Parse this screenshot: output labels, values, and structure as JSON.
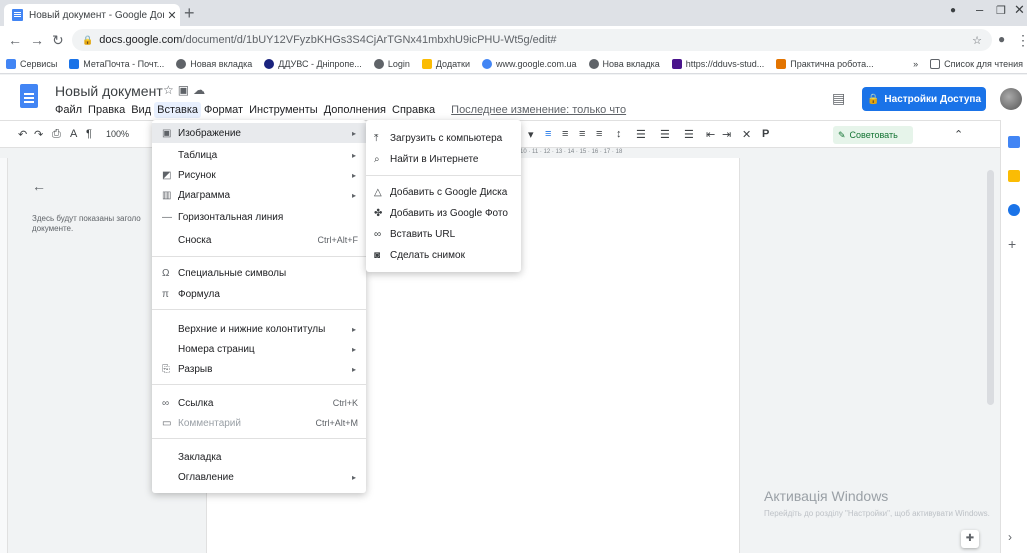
{
  "browser": {
    "tab_title": "Новый документ - Google Доку",
    "url_domain": "docs.google.com",
    "url_path": "/document/d/1bUY12VFyzbKHGs3S4CjArTGNx41mbxhU9icPHU-Wt5g/edit#",
    "bookmarks": [
      "Сервисы",
      "МетаПочта - Почт...",
      "Новая вкладка",
      "ДДУВС - Дніпропе...",
      "Login",
      "Додатки",
      "www.google.com.ua",
      "Нова вкладка",
      "https://dduvs-stud...",
      "Практична робота..."
    ],
    "bookmarks_more": "»",
    "reading_list": "Список для чтения"
  },
  "doc": {
    "title": "Новый документ",
    "menus": [
      "Файл",
      "Правка",
      "Вид",
      "Вставка",
      "Формат",
      "Инструменты",
      "Дополнения",
      "Справка"
    ],
    "last_edit": "Последнее изменение: только что",
    "share": "Настройки Доступа",
    "zoom": "100%",
    "suggest": "Советовать",
    "outline_hint": "Здесь будут показаны заголо документе.",
    "ruler": "10 · 11 · 12 · 13 · 14 · 15 · 16 · 17 · 18"
  },
  "insert_menu": {
    "image": "Изображение",
    "table": "Таблица",
    "drawing": "Рисунок",
    "chart": "Диаграмма",
    "hline": "Горизонтальная линия",
    "footnote": "Сноска",
    "footnote_sc": "Ctrl+Alt+F",
    "special": "Специальные символы",
    "equation": "Формула",
    "headers": "Верхние и нижние колонтитулы",
    "pagenums": "Номера страниц",
    "break": "Разрыв",
    "link": "Ссылка",
    "link_sc": "Ctrl+K",
    "comment": "Комментарий",
    "comment_sc": "Ctrl+Alt+M",
    "bookmark": "Закладка",
    "toc": "Оглавление"
  },
  "image_menu": {
    "upload": "Загрузить с компьютера",
    "search": "Найти в Интернете",
    "drive": "Добавить с Google Диска",
    "photos": "Добавить из Google Фото",
    "url": "Вставить URL",
    "camera": "Сделать снимок"
  },
  "watermark": {
    "title": "Активація Windows",
    "text": "Перейдіть до розділу \"Настройки\", щоб активувати Windows."
  }
}
